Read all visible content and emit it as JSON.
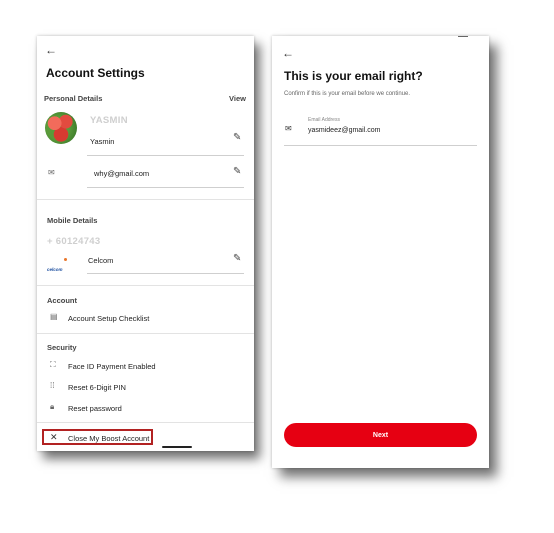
{
  "left": {
    "title": "Account Settings",
    "personal_details": {
      "label": "Personal Details",
      "view_label": "View",
      "username_display": "YASMIN",
      "name": "Yasmin",
      "email": "why@gmail.com"
    },
    "mobile_details": {
      "label": "Mobile Details",
      "number": "+ 60124743",
      "carrier_logo_text": "celcom",
      "carrier": "Celcom"
    },
    "account": {
      "label": "Account",
      "items": [
        "Account Setup Checklist"
      ]
    },
    "security": {
      "label": "Security",
      "items": [
        "Face ID Payment Enabled",
        "Reset 6-Digit PIN",
        "Reset password"
      ]
    },
    "close_account": "Close My Boost Account",
    "icons": {
      "back": "back-arrow-icon",
      "edit": "pencil-icon",
      "email": "envelope-icon",
      "checklist": "clipboard-icon",
      "face_id": "face-scan-icon",
      "pin": "keypad-icon",
      "password": "lock-icon",
      "close": "close-icon"
    },
    "highlight_color": "#b22222"
  },
  "right": {
    "title": "This is your email right?",
    "subtitle": "Confirm if this is your email before we continue.",
    "field_label": "Email Address",
    "email": "yasmideez@gmail.com",
    "next_label": "Next",
    "accent_color": "#e60012"
  }
}
